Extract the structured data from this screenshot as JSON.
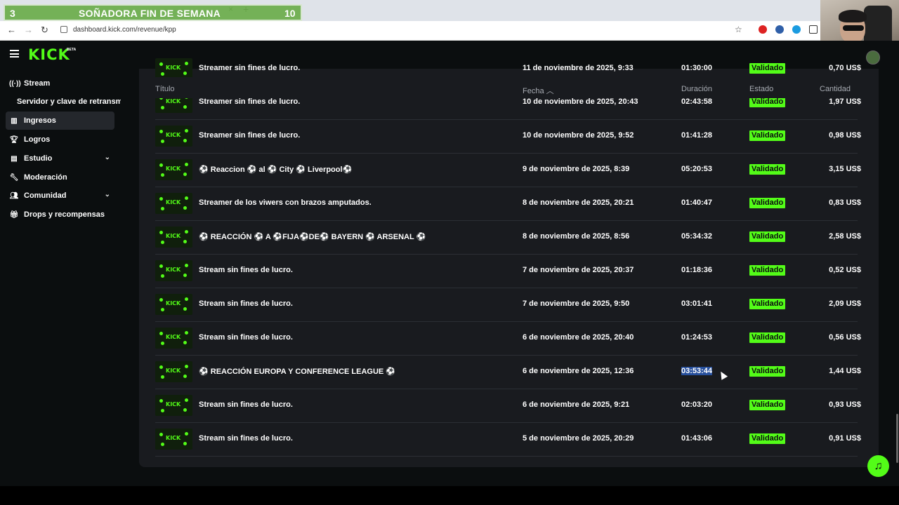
{
  "overlay": {
    "left_num": "3",
    "title": "SOÑADORA FIN DE SEMANA",
    "right_num": "10"
  },
  "browser": {
    "url": "dashboard.kick.com/revenue/kpp",
    "new_tab": "+",
    "close_tab": "×"
  },
  "app": {
    "logo": "KICK",
    "beta": "BETA"
  },
  "sidebar": {
    "items": [
      {
        "label": "Stream",
        "icon": "broadcast-icon"
      },
      {
        "label": "Servidor y clave de retransm"
      },
      {
        "label": "Ingresos",
        "icon": "chart-icon",
        "active": true
      },
      {
        "label": "Logros",
        "icon": "trophy-icon"
      },
      {
        "label": "Estudio",
        "icon": "studio-icon",
        "expandable": true
      },
      {
        "label": "Moderación",
        "icon": "wrench-icon"
      },
      {
        "label": "Comunidad",
        "icon": "community-icon",
        "expandable": true
      },
      {
        "label": "Drops y recompensas",
        "icon": "gift-icon"
      }
    ]
  },
  "table": {
    "headers": {
      "title": "Título",
      "date": "Fecha",
      "duration": "Duración",
      "status": "Estado",
      "amount": "Cantidad"
    },
    "sort": "ascending",
    "rows": [
      {
        "title": "Streamer sin fines de lucro.",
        "date": "11 de noviembre de 2025, 9:33",
        "duration": "01:30:00",
        "status": "Validado",
        "amount": "0,70 US$"
      },
      {
        "title": "Streamer sin fines de lucro.",
        "date": "10 de noviembre de 2025, 20:43",
        "duration": "02:43:58",
        "status": "Validado",
        "amount": "1,97 US$"
      },
      {
        "title": "Streamer sin fines de lucro.",
        "date": "10 de noviembre de 2025, 9:52",
        "duration": "01:41:28",
        "status": "Validado",
        "amount": "0,98 US$"
      },
      {
        "title": "⚽ Reaccion ⚽ al ⚽ City ⚽ Liverpool⚽",
        "date": "9 de noviembre de 2025, 8:39",
        "duration": "05:20:53",
        "status": "Validado",
        "amount": "3,15 US$"
      },
      {
        "title": "Streamer de los viwers con brazos amputados.",
        "date": "8 de noviembre de 2025, 20:21",
        "duration": "01:40:47",
        "status": "Validado",
        "amount": "0,83 US$"
      },
      {
        "title": "⚽ REACCIÓN ⚽ A ⚽FIJA⚽DE⚽ BAYERN ⚽ ARSENAL ⚽",
        "date": "8 de noviembre de 2025, 8:56",
        "duration": "05:34:32",
        "status": "Validado",
        "amount": "2,58 US$"
      },
      {
        "title": "Stream sin fines de lucro.",
        "date": "7 de noviembre de 2025, 20:37",
        "duration": "01:18:36",
        "status": "Validado",
        "amount": "0,52 US$"
      },
      {
        "title": "Stream sin fines de lucro.",
        "date": "7 de noviembre de 2025, 9:50",
        "duration": "03:01:41",
        "status": "Validado",
        "amount": "2,09 US$"
      },
      {
        "title": "Stream sin fines de lucro.",
        "date": "6 de noviembre de 2025, 20:40",
        "duration": "01:24:53",
        "status": "Validado",
        "amount": "0,56 US$"
      },
      {
        "title": "⚽ REACCIÓN EUROPA Y CONFERENCE LEAGUE ⚽",
        "date": "6 de noviembre de 2025, 12:36",
        "duration": "03:53:44",
        "status": "Validado",
        "amount": "1,44 US$",
        "duration_selected": true
      },
      {
        "title": "Stream sin fines de lucro.",
        "date": "6 de noviembre de 2025, 9:21",
        "duration": "02:03:20",
        "status": "Validado",
        "amount": "0,93 US$"
      },
      {
        "title": "Stream sin fines de lucro.",
        "date": "5 de noviembre de 2025, 20:29",
        "duration": "01:43:06",
        "status": "Validado",
        "amount": "0,91 US$"
      }
    ]
  },
  "colors": {
    "accent": "#53fc18",
    "panel": "#191b1f",
    "background": "#0b0e0f"
  }
}
